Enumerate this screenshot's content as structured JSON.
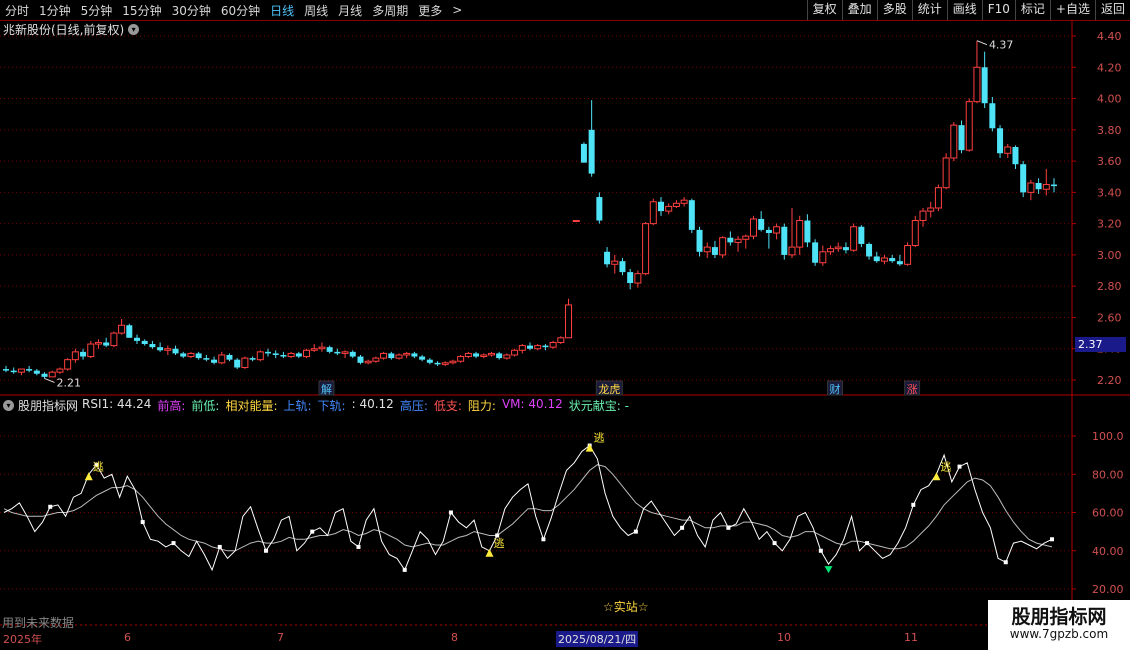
{
  "toolbar": {
    "periods": [
      {
        "label": "分时",
        "active": false
      },
      {
        "label": "1分钟",
        "active": false
      },
      {
        "label": "5分钟",
        "active": false
      },
      {
        "label": "15分钟",
        "active": false
      },
      {
        "label": "30分钟",
        "active": false
      },
      {
        "label": "60分钟",
        "active": false
      },
      {
        "label": "日线",
        "active": true
      },
      {
        "label": "周线",
        "active": false
      },
      {
        "label": "月线",
        "active": false
      },
      {
        "label": "多周期",
        "active": false
      },
      {
        "label": "更多",
        "active": false
      }
    ],
    "more_arrow": ">",
    "right_buttons": [
      "复权",
      "叠加",
      "多股",
      "统计",
      "画线",
      "F10",
      "标记",
      "+自选",
      "返回"
    ]
  },
  "main_chart": {
    "title": "兆新股份(日线,前复权)",
    "y_ticks": [
      "4.40",
      "4.20",
      "4.00",
      "3.80",
      "3.60",
      "3.40",
      "3.20",
      "3.00",
      "2.80",
      "2.60",
      "2.40",
      "2.20"
    ],
    "current_price": "2.37",
    "max_label": "4.37",
    "min_label": "2.21",
    "events": [
      {
        "label": "解",
        "color": "#4fc3f7"
      },
      {
        "label": "龙虎",
        "color": "#ffd740"
      },
      {
        "label": "财",
        "color": "#4fc3f7"
      },
      {
        "label": "涨",
        "color": "#ff5252"
      }
    ]
  },
  "indicator": {
    "name": "股朋指标网",
    "items": [
      {
        "text": "RSI1: 44.24",
        "color": "#e0e0e0"
      },
      {
        "text": "前高:",
        "color": "#e040fb"
      },
      {
        "text": "前低:",
        "color": "#69f0ae"
      },
      {
        "text": "相对能量:",
        "color": "#ffd740"
      },
      {
        "text": "上轨:",
        "color": "#448aff"
      },
      {
        "text": "下轨:",
        "color": "#448aff"
      },
      {
        "text": ": 40.12",
        "color": "#e0e0e0"
      },
      {
        "text": "高压:",
        "color": "#448aff"
      },
      {
        "text": "低支:",
        "color": "#ff5252"
      },
      {
        "text": "阻力:",
        "color": "#ffd740"
      },
      {
        "text": "VM: 40.12",
        "color": "#e040fb"
      },
      {
        "text": "状元献宝: -",
        "color": "#69f0ae"
      }
    ],
    "y_ticks": [
      "100.0",
      "80.00",
      "60.00",
      "40.00",
      "20.00"
    ],
    "escape_label": "逃",
    "shizhan": "☆实站☆",
    "future_text": "用到未来数据"
  },
  "date_axis": {
    "labels": [
      "2025年",
      "6",
      "7",
      "8",
      "2025/08/21/四",
      "10",
      "11"
    ]
  },
  "watermark": {
    "title": "股朋指标网",
    "url": "www.7gpzb.com"
  },
  "colors": {
    "up": "#ff4040",
    "down": "#4fe3f7",
    "grid": "#7a0000",
    "axis": "#b00000"
  },
  "chart_data": {
    "type": "candlestick",
    "ohlc": [
      [
        2.27,
        2.29,
        2.25,
        2.26
      ],
      [
        2.26,
        2.28,
        2.24,
        2.25
      ],
      [
        2.25,
        2.27,
        2.23,
        2.27
      ],
      [
        2.27,
        2.29,
        2.25,
        2.26
      ],
      [
        2.26,
        2.27,
        2.23,
        2.24
      ],
      [
        2.24,
        2.25,
        2.21,
        2.22
      ],
      [
        2.22,
        2.26,
        2.22,
        2.25
      ],
      [
        2.25,
        2.28,
        2.24,
        2.27
      ],
      [
        2.27,
        2.34,
        2.26,
        2.33
      ],
      [
        2.33,
        2.4,
        2.31,
        2.38
      ],
      [
        2.38,
        2.4,
        2.33,
        2.35
      ],
      [
        2.35,
        2.45,
        2.34,
        2.43
      ],
      [
        2.43,
        2.46,
        2.4,
        2.44
      ],
      [
        2.44,
        2.47,
        2.41,
        2.42
      ],
      [
        2.42,
        2.51,
        2.41,
        2.5
      ],
      [
        2.5,
        2.59,
        2.49,
        2.55
      ],
      [
        2.55,
        2.56,
        2.47,
        2.47
      ],
      [
        2.47,
        2.49,
        2.43,
        2.45
      ],
      [
        2.45,
        2.46,
        2.42,
        2.43
      ],
      [
        2.43,
        2.45,
        2.4,
        2.41
      ],
      [
        2.41,
        2.44,
        2.38,
        2.39
      ],
      [
        2.39,
        2.42,
        2.36,
        2.4
      ],
      [
        2.4,
        2.42,
        2.36,
        2.37
      ],
      [
        2.37,
        2.38,
        2.34,
        2.35
      ],
      [
        2.35,
        2.38,
        2.34,
        2.37
      ],
      [
        2.37,
        2.38,
        2.33,
        2.34
      ],
      [
        2.34,
        2.36,
        2.32,
        2.33
      ],
      [
        2.33,
        2.35,
        2.3,
        2.31
      ],
      [
        2.31,
        2.38,
        2.3,
        2.36
      ],
      [
        2.36,
        2.37,
        2.32,
        2.33
      ],
      [
        2.33,
        2.34,
        2.27,
        2.28
      ],
      [
        2.28,
        2.35,
        2.27,
        2.34
      ],
      [
        2.34,
        2.35,
        2.32,
        2.33
      ],
      [
        2.33,
        2.39,
        2.32,
        2.38
      ],
      [
        2.38,
        2.4,
        2.35,
        2.37
      ],
      [
        2.37,
        2.39,
        2.34,
        2.36
      ],
      [
        2.36,
        2.38,
        2.34,
        2.35
      ],
      [
        2.35,
        2.38,
        2.34,
        2.37
      ],
      [
        2.37,
        2.38,
        2.34,
        2.35
      ],
      [
        2.35,
        2.4,
        2.34,
        2.39
      ],
      [
        2.39,
        2.43,
        2.38,
        2.4
      ],
      [
        2.4,
        2.44,
        2.38,
        2.41
      ],
      [
        2.41,
        2.42,
        2.37,
        2.38
      ],
      [
        2.38,
        2.4,
        2.36,
        2.37
      ],
      [
        2.37,
        2.39,
        2.34,
        2.38
      ],
      [
        2.38,
        2.39,
        2.34,
        2.35
      ],
      [
        2.35,
        2.36,
        2.3,
        2.31
      ],
      [
        2.31,
        2.33,
        2.3,
        2.32
      ],
      [
        2.32,
        2.35,
        2.31,
        2.34
      ],
      [
        2.34,
        2.38,
        2.33,
        2.37
      ],
      [
        2.37,
        2.38,
        2.33,
        2.34
      ],
      [
        2.34,
        2.37,
        2.33,
        2.36
      ],
      [
        2.36,
        2.38,
        2.34,
        2.37
      ],
      [
        2.37,
        2.38,
        2.34,
        2.35
      ],
      [
        2.35,
        2.36,
        2.32,
        2.33
      ],
      [
        2.33,
        2.34,
        2.3,
        2.31
      ],
      [
        2.31,
        2.32,
        2.29,
        2.3
      ],
      [
        2.3,
        2.32,
        2.29,
        2.31
      ],
      [
        2.31,
        2.33,
        2.3,
        2.32
      ],
      [
        2.32,
        2.36,
        2.31,
        2.35
      ],
      [
        2.35,
        2.38,
        2.34,
        2.37
      ],
      [
        2.37,
        2.38,
        2.34,
        2.35
      ],
      [
        2.35,
        2.37,
        2.34,
        2.36
      ],
      [
        2.36,
        2.38,
        2.35,
        2.37
      ],
      [
        2.37,
        2.38,
        2.33,
        2.34
      ],
      [
        2.34,
        2.37,
        2.33,
        2.36
      ],
      [
        2.36,
        2.4,
        2.35,
        2.39
      ],
      [
        2.39,
        2.43,
        2.37,
        2.42
      ],
      [
        2.42,
        2.44,
        2.39,
        2.4
      ],
      [
        2.4,
        2.43,
        2.39,
        2.42
      ],
      [
        2.42,
        2.43,
        2.39,
        2.41
      ],
      [
        2.41,
        2.45,
        2.4,
        2.44
      ],
      [
        2.44,
        2.48,
        2.43,
        2.47
      ],
      [
        2.47,
        2.72,
        2.47,
        2.68
      ],
      [
        3.22,
        3.22,
        3.22,
        3.22
      ],
      [
        3.71,
        3.72,
        3.59,
        3.59
      ],
      [
        3.8,
        3.99,
        3.5,
        3.52
      ],
      [
        3.37,
        3.4,
        3.2,
        3.22
      ],
      [
        3.02,
        3.05,
        2.92,
        2.94
      ],
      [
        2.94,
        3.0,
        2.88,
        2.96
      ],
      [
        2.96,
        2.98,
        2.87,
        2.89
      ],
      [
        2.89,
        2.91,
        2.78,
        2.82
      ],
      [
        2.82,
        2.9,
        2.79,
        2.88
      ],
      [
        2.88,
        3.21,
        2.87,
        3.2
      ],
      [
        3.2,
        3.36,
        3.19,
        3.34
      ],
      [
        3.34,
        3.37,
        3.25,
        3.28
      ],
      [
        3.28,
        3.33,
        3.26,
        3.31
      ],
      [
        3.31,
        3.35,
        3.3,
        3.33
      ],
      [
        3.33,
        3.37,
        3.31,
        3.35
      ],
      [
        3.35,
        3.36,
        3.14,
        3.16
      ],
      [
        3.16,
        3.18,
        2.99,
        3.02
      ],
      [
        3.02,
        3.08,
        2.98,
        3.05
      ],
      [
        3.05,
        3.09,
        2.98,
        3.0
      ],
      [
        3.0,
        3.12,
        2.98,
        3.11
      ],
      [
        3.11,
        3.15,
        3.06,
        3.08
      ],
      [
        3.08,
        3.12,
        3.02,
        3.1
      ],
      [
        3.1,
        3.13,
        3.04,
        3.12
      ],
      [
        3.12,
        3.25,
        3.1,
        3.23
      ],
      [
        3.23,
        3.28,
        3.15,
        3.16
      ],
      [
        3.16,
        3.18,
        3.04,
        3.14
      ],
      [
        3.14,
        3.2,
        3.1,
        3.18
      ],
      [
        3.18,
        3.2,
        2.97,
        3.0
      ],
      [
        3.0,
        3.3,
        2.98,
        3.05
      ],
      [
        3.05,
        3.25,
        3.0,
        3.22
      ],
      [
        3.22,
        3.26,
        3.05,
        3.08
      ],
      [
        3.08,
        3.1,
        2.93,
        2.95
      ],
      [
        2.95,
        3.06,
        2.93,
        3.02
      ],
      [
        3.02,
        3.06,
        3.0,
        3.04
      ],
      [
        3.04,
        3.08,
        3.02,
        3.05
      ],
      [
        3.05,
        3.08,
        3.01,
        3.03
      ],
      [
        3.03,
        3.2,
        3.02,
        3.18
      ],
      [
        3.18,
        3.19,
        3.05,
        3.07
      ],
      [
        3.07,
        3.08,
        2.97,
        2.99
      ],
      [
        2.99,
        3.02,
        2.95,
        2.96
      ],
      [
        2.96,
        3.0,
        2.94,
        2.98
      ],
      [
        2.98,
        3.0,
        2.95,
        2.96
      ],
      [
        2.96,
        3.0,
        2.93,
        2.94
      ],
      [
        2.94,
        3.08,
        2.93,
        3.06
      ],
      [
        3.06,
        3.25,
        3.05,
        3.22
      ],
      [
        3.22,
        3.3,
        3.18,
        3.28
      ],
      [
        3.28,
        3.34,
        3.24,
        3.3
      ],
      [
        3.3,
        3.45,
        3.28,
        3.43
      ],
      [
        3.43,
        3.65,
        3.42,
        3.62
      ],
      [
        3.62,
        3.85,
        3.6,
        3.83
      ],
      [
        3.83,
        3.86,
        3.65,
        3.67
      ],
      [
        3.67,
        4.0,
        3.66,
        3.98
      ],
      [
        3.98,
        4.37,
        3.97,
        4.2
      ],
      [
        4.2,
        4.3,
        3.94,
        3.97
      ],
      [
        3.97,
        4.01,
        3.79,
        3.81
      ],
      [
        3.81,
        3.83,
        3.62,
        3.65
      ],
      [
        3.65,
        3.71,
        3.62,
        3.69
      ],
      [
        3.69,
        3.7,
        3.55,
        3.58
      ],
      [
        3.58,
        3.6,
        3.37,
        3.4
      ],
      [
        3.4,
        3.48,
        3.35,
        3.46
      ],
      [
        3.46,
        3.49,
        3.39,
        3.42
      ],
      [
        3.42,
        3.55,
        3.38,
        3.45
      ],
      [
        3.45,
        3.49,
        3.4,
        3.44
      ]
    ],
    "rsi": [
      60,
      62,
      65,
      58,
      50,
      55,
      63,
      64,
      58,
      68,
      70,
      80,
      85,
      78,
      80,
      68,
      79,
      72,
      55,
      46,
      45,
      42,
      44,
      40,
      37,
      45,
      38,
      30,
      42,
      36,
      40,
      58,
      63,
      51,
      40,
      46,
      56,
      58,
      40,
      44,
      50,
      52,
      48,
      60,
      62,
      45,
      42,
      56,
      62,
      45,
      38,
      36,
      30,
      40,
      50,
      46,
      38,
      45,
      60,
      55,
      52,
      56,
      42,
      40,
      48,
      62,
      68,
      72,
      75,
      58,
      46,
      57,
      70,
      82,
      86,
      92,
      95,
      88,
      70,
      58,
      52,
      48,
      50,
      62,
      66,
      60,
      54,
      48,
      52,
      58,
      48,
      42,
      56,
      60,
      52,
      54,
      62,
      55,
      46,
      50,
      44,
      40,
      46,
      58,
      60,
      52,
      40,
      33,
      38,
      46,
      58,
      40,
      44,
      40,
      36,
      38,
      44,
      52,
      64,
      72,
      74,
      80,
      90,
      76,
      84,
      86,
      72,
      60,
      52,
      36,
      34,
      44,
      45,
      43,
      41,
      44,
      46
    ],
    "rsi_ma": [
      62,
      60,
      59,
      58,
      58,
      58,
      59,
      60,
      60,
      61,
      63,
      66,
      69,
      71,
      73,
      73,
      74,
      72,
      68,
      63,
      58,
      54,
      51,
      48,
      46,
      45,
      44,
      42,
      41,
      40,
      40,
      42,
      44,
      45,
      44,
      44,
      45,
      47,
      46,
      46,
      47,
      48,
      48,
      49,
      51,
      50,
      48,
      49,
      51,
      50,
      48,
      46,
      43,
      42,
      43,
      44,
      43,
      43,
      45,
      47,
      48,
      50,
      49,
      48,
      48,
      51,
      54,
      58,
      62,
      62,
      61,
      61,
      64,
      68,
      72,
      77,
      82,
      85,
      84,
      80,
      75,
      70,
      65,
      62,
      60,
      59,
      58,
      57,
      56,
      56,
      54,
      52,
      52,
      53,
      53,
      53,
      55,
      55,
      54,
      53,
      51,
      48,
      47,
      48,
      50,
      50,
      48,
      46,
      44,
      43,
      45,
      45,
      44,
      43,
      42,
      41,
      41,
      42,
      45,
      49,
      53,
      58,
      64,
      68,
      72,
      76,
      78,
      77,
      74,
      68,
      61,
      55,
      50,
      46,
      44,
      43,
      42
    ],
    "price_ylim": [
      2.1,
      4.5
    ],
    "rsi_ylim": [
      10,
      120
    ]
  }
}
